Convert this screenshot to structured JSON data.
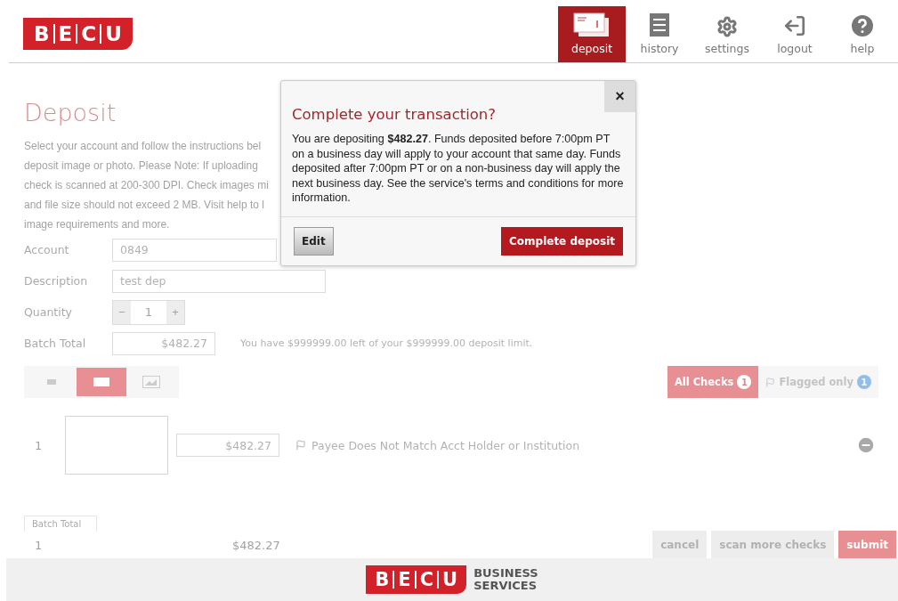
{
  "header": {
    "logo_letters": [
      "B",
      "E",
      "C",
      "U"
    ],
    "nav": [
      {
        "label": "deposit",
        "kind": "deposit",
        "selected": true
      },
      {
        "label": "history",
        "kind": "history",
        "selected": false
      },
      {
        "label": "settings",
        "kind": "settings",
        "selected": false
      },
      {
        "label": "logout",
        "kind": "logout",
        "selected": false
      },
      {
        "label": "help",
        "kind": "help",
        "selected": false
      }
    ]
  },
  "page": {
    "title": "Deposit",
    "intro_lines": [
      "Select your account and follow the instructions bel",
      "deposit image or photo. Please Note: If uploading",
      "check is scanned at 200-300 DPI. Check images mi",
      "and file size should not exceed 2 MB. Visit help to l",
      "image requirements and more."
    ],
    "form": [
      {
        "label": "Account",
        "kind": "field",
        "value": "0849"
      },
      {
        "label": "Description",
        "kind": "field",
        "value": "test dep"
      },
      {
        "label": "Quantity",
        "kind": "stepper",
        "value": "1",
        "minus": "−",
        "plus": "+"
      },
      {
        "label": "Batch Total",
        "kind": "total",
        "value": "$482.27",
        "note": "You have $999999.00 left of your $999999.00 deposit limit."
      }
    ],
    "view_buttons": [
      {
        "kind": "list",
        "selected": false
      },
      {
        "kind": "card",
        "selected": true
      },
      {
        "kind": "image",
        "selected": false
      }
    ],
    "filters": [
      {
        "kind": "all",
        "label": "All Checks",
        "count": "1",
        "selected": true
      },
      {
        "kind": "flagged",
        "label": "Flagged only",
        "count": "1",
        "selected": false
      }
    ],
    "checks": [
      {
        "number": "1",
        "amount": "$482.27",
        "flag": "Payee Does Not Match Acct Holder or Institution"
      }
    ],
    "batch_table": {
      "tab": "Batch Total",
      "rows": [
        {
          "count": "1",
          "total": "$482.27"
        }
      ]
    },
    "actions": [
      {
        "label": "cancel",
        "kind": "plain"
      },
      {
        "label": "scan more checks",
        "kind": "plain"
      },
      {
        "label": "submit",
        "kind": "primary"
      }
    ]
  },
  "dialog": {
    "title": "Complete your transaction?",
    "close": "×",
    "body": "You are depositing **$482.27**. Funds deposited before 7:00pm PT on a business day will apply to your account that same day. Funds deposited after 7:00pm PT or on a non-business day will apply the next business day. See the service's terms and conditions for more information.",
    "edit": "Edit",
    "confirm": "Complete deposit"
  },
  "footer": {
    "logo_letters": [
      "B",
      "E",
      "C",
      "U"
    ],
    "tagline": [
      "BUSINESS",
      "SERVICES"
    ]
  }
}
